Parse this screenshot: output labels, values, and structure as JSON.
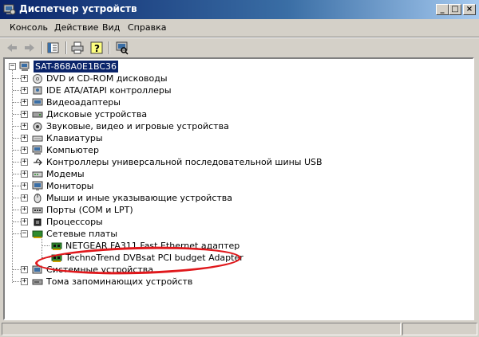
{
  "window": {
    "title": "Диспетчер устройств",
    "controls": [
      "_",
      "□",
      "×"
    ]
  },
  "menu": [
    "Консоль",
    "Действие",
    "Вид",
    "Справка"
  ],
  "toolbar": [
    "back-arrow-icon",
    "forward-arrow-icon",
    "properties-icon",
    "print-icon",
    "help-icon",
    "scan-hardware-icon"
  ],
  "tree": {
    "root": "SAT-868A0E1BC36",
    "categories": [
      {
        "label": "DVD и CD-ROM дисководы",
        "icon": "cdrom-icon"
      },
      {
        "label": "IDE ATA/ATAPI контроллеры",
        "icon": "ide-controller-icon"
      },
      {
        "label": "Видеоадаптеры",
        "icon": "display-adapter-icon"
      },
      {
        "label": "Дисковые устройства",
        "icon": "disk-drive-icon"
      },
      {
        "label": "Звуковые, видео и игровые устройства",
        "icon": "sound-icon"
      },
      {
        "label": "Клавиатуры",
        "icon": "keyboard-icon"
      },
      {
        "label": "Компьютер",
        "icon": "computer-icon"
      },
      {
        "label": "Контроллеры универсальной последовательной шины USB",
        "icon": "usb-icon"
      },
      {
        "label": "Модемы",
        "icon": "modem-icon"
      },
      {
        "label": "Мониторы",
        "icon": "monitor-icon"
      },
      {
        "label": "Мыши и иные указывающие устройства",
        "icon": "mouse-icon"
      },
      {
        "label": "Порты (COM и LPT)",
        "icon": "port-icon"
      },
      {
        "label": "Процессоры",
        "icon": "processor-icon"
      }
    ],
    "network": {
      "label": "Сетевые платы",
      "icon": "network-card-icon",
      "children": [
        "NETGEAR FA311 Fast Ethernet адаптер",
        "TechnoTrend DVBsat PCI budget Adapter"
      ]
    },
    "trailing": [
      {
        "label": "Системные устройства",
        "icon": "system-device-icon"
      },
      {
        "label": "Тома запоминающих устройств",
        "icon": "storage-volume-icon"
      }
    ]
  },
  "colors": {
    "titlebar_start": "#0a246a",
    "titlebar_end": "#a6caf0",
    "selection": "#0a246a",
    "highlight_ellipse": "#e0181c"
  }
}
